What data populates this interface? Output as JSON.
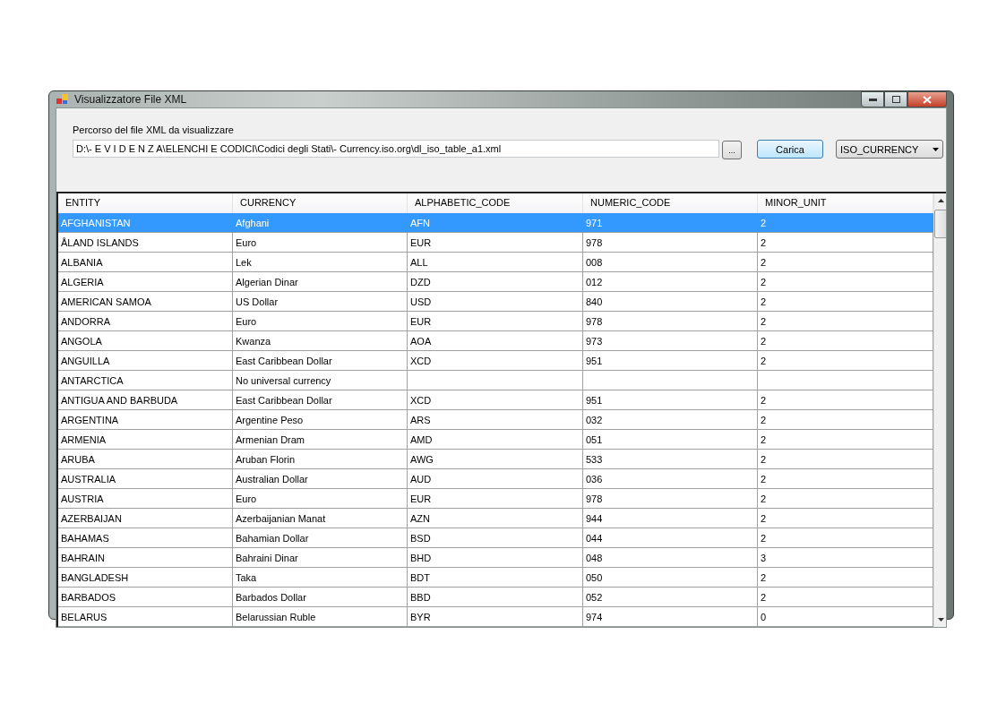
{
  "window": {
    "title": "Visualizzatore File XML"
  },
  "path_label": "Percorso del file XML da visualizzare",
  "path_field": {
    "value": "D:\\- E V I D E N Z A\\ELENCHI E CODICI\\Codici degli Stati\\- Currency.iso.org\\dl_iso_table_a1.xml"
  },
  "browse_button": "...",
  "load_button": "Carica",
  "table_select": {
    "value": "ISO_CURRENCY"
  },
  "table": {
    "columns": [
      "ENTITY",
      "CURRENCY",
      "ALPHABETIC_CODE",
      "NUMERIC_CODE",
      "MINOR_UNIT"
    ],
    "rows": [
      {
        "entity": "AFGHANISTAN",
        "currency": "Afghani",
        "alphabetic_code": "AFN",
        "numeric_code": "971",
        "minor_unit": "2",
        "selected": true
      },
      {
        "entity": "ÅLAND ISLANDS",
        "currency": "Euro",
        "alphabetic_code": "EUR",
        "numeric_code": "978",
        "minor_unit": "2",
        "selected": false
      },
      {
        "entity": "ALBANIA",
        "currency": "Lek",
        "alphabetic_code": "ALL",
        "numeric_code": "008",
        "minor_unit": "2",
        "selected": false
      },
      {
        "entity": "ALGERIA",
        "currency": "Algerian Dinar",
        "alphabetic_code": "DZD",
        "numeric_code": "012",
        "minor_unit": "2",
        "selected": false
      },
      {
        "entity": "AMERICAN SAMOA",
        "currency": "US Dollar",
        "alphabetic_code": "USD",
        "numeric_code": "840",
        "minor_unit": "2",
        "selected": false
      },
      {
        "entity": "ANDORRA",
        "currency": "Euro",
        "alphabetic_code": "EUR",
        "numeric_code": "978",
        "minor_unit": "2",
        "selected": false
      },
      {
        "entity": "ANGOLA",
        "currency": "Kwanza",
        "alphabetic_code": "AOA",
        "numeric_code": "973",
        "minor_unit": "2",
        "selected": false
      },
      {
        "entity": "ANGUILLA",
        "currency": "East Caribbean Dollar",
        "alphabetic_code": "XCD",
        "numeric_code": "951",
        "minor_unit": "2",
        "selected": false
      },
      {
        "entity": "ANTARCTICA",
        "currency": "No universal currency",
        "selected": false
      },
      {
        "entity": "ANTIGUA AND BARBUDA",
        "currency": "East Caribbean Dollar",
        "alphabetic_code": "XCD",
        "numeric_code": "951",
        "minor_unit": "2",
        "selected": false
      },
      {
        "entity": "ARGENTINA",
        "currency": "Argentine Peso",
        "alphabetic_code": "ARS",
        "numeric_code": "032",
        "minor_unit": "2",
        "selected": false
      },
      {
        "entity": "ARMENIA",
        "currency": "Armenian Dram",
        "alphabetic_code": "AMD",
        "numeric_code": "051",
        "minor_unit": "2",
        "selected": false
      },
      {
        "entity": "ARUBA",
        "currency": "Aruban Florin",
        "alphabetic_code": "AWG",
        "numeric_code": "533",
        "minor_unit": "2",
        "selected": false
      },
      {
        "entity": "AUSTRALIA",
        "currency": "Australian Dollar",
        "alphabetic_code": "AUD",
        "numeric_code": "036",
        "minor_unit": "2",
        "selected": false
      },
      {
        "entity": "AUSTRIA",
        "currency": "Euro",
        "alphabetic_code": "EUR",
        "numeric_code": "978",
        "minor_unit": "2",
        "selected": false
      },
      {
        "entity": "AZERBAIJAN",
        "currency": "Azerbaijanian Manat",
        "alphabetic_code": "AZN",
        "numeric_code": "944",
        "minor_unit": "2",
        "selected": false
      },
      {
        "entity": "BAHAMAS",
        "currency": "Bahamian Dollar",
        "alphabetic_code": "BSD",
        "numeric_code": "044",
        "minor_unit": "2",
        "selected": false
      },
      {
        "entity": "BAHRAIN",
        "currency": "Bahraini Dinar",
        "alphabetic_code": "BHD",
        "numeric_code": "048",
        "minor_unit": "3",
        "selected": false
      },
      {
        "entity": "BANGLADESH",
        "currency": "Taka",
        "alphabetic_code": "BDT",
        "numeric_code": "050",
        "minor_unit": "2",
        "selected": false
      },
      {
        "entity": "BARBADOS",
        "currency": "Barbados Dollar",
        "alphabetic_code": "BBD",
        "numeric_code": "052",
        "minor_unit": "2",
        "selected": false
      },
      {
        "entity": "BELARUS",
        "currency": "Belarussian Ruble",
        "alphabetic_code": "BYR",
        "numeric_code": "974",
        "minor_unit": "0",
        "selected": false
      }
    ]
  }
}
